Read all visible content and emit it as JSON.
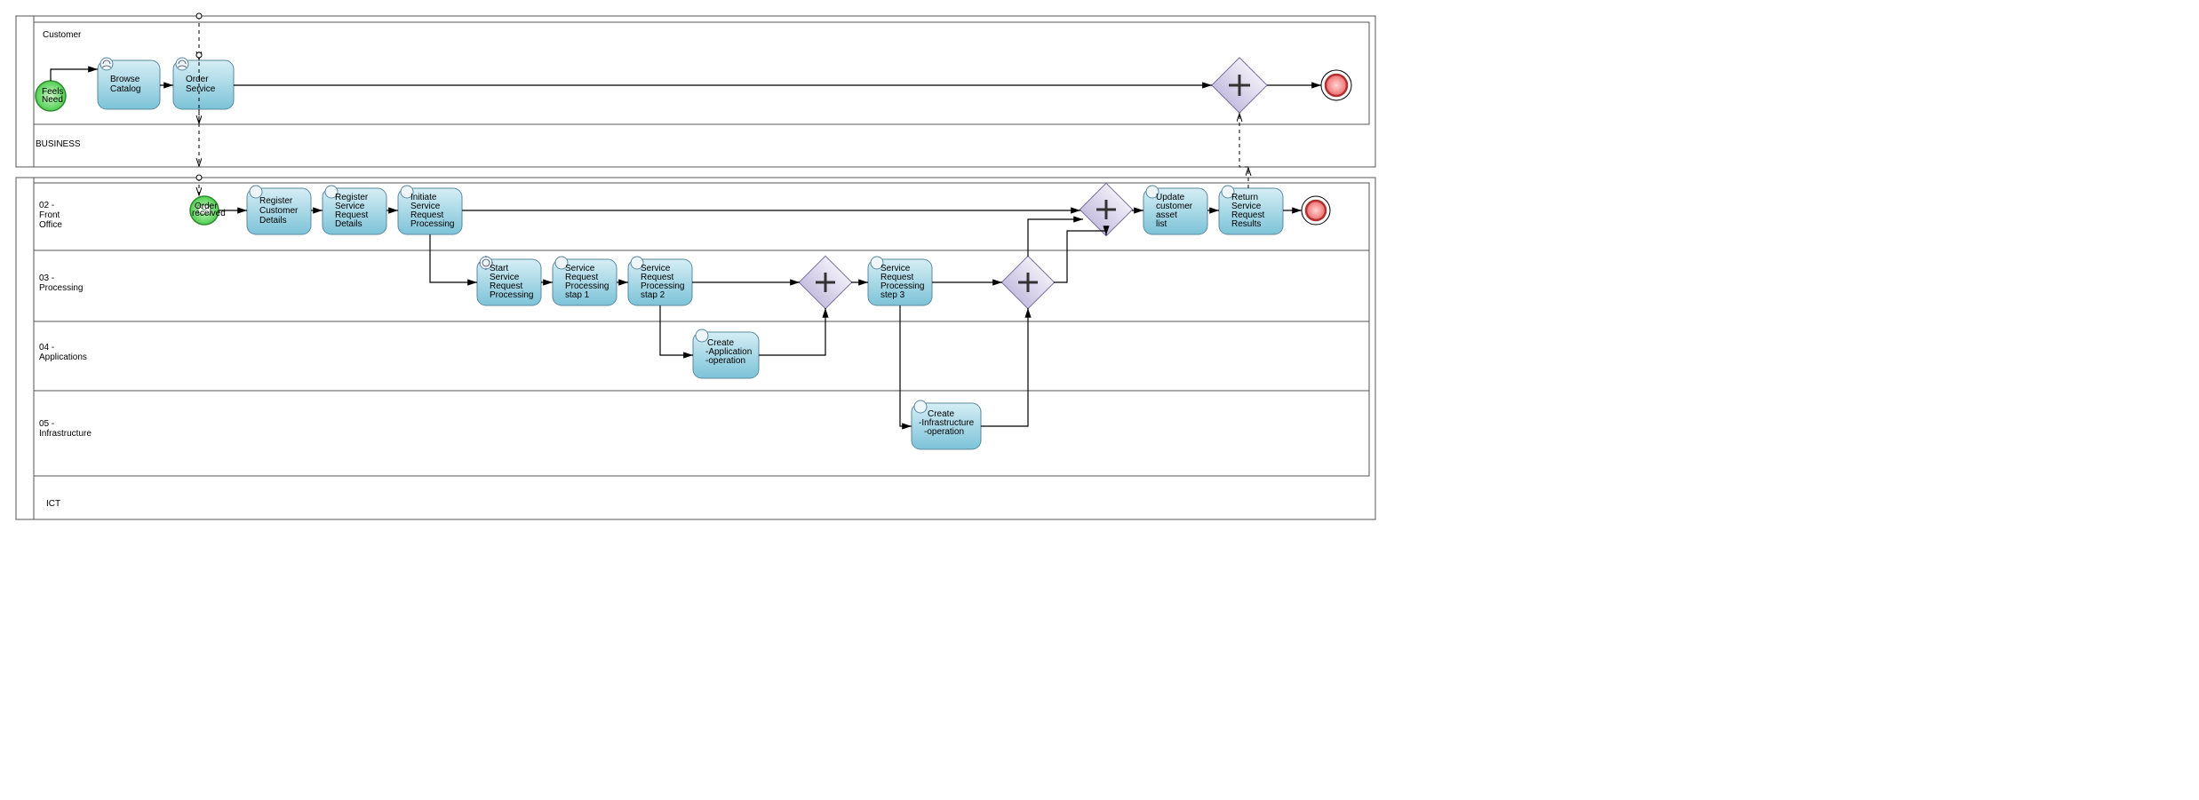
{
  "pools": {
    "business": {
      "label": "BUSINESS"
    },
    "customerLane": {
      "label": "Customer"
    },
    "ict": {
      "label": "ICT"
    },
    "frontOffice": {
      "label": "02 -\nFront\nOffice"
    },
    "processing": {
      "label": "03 -\nProcessing"
    },
    "applications": {
      "label": "04 -\nApplications"
    },
    "infrastructure": {
      "label": "05 -\nInfrastructure"
    }
  },
  "events": {
    "feelsNeed": {
      "label": "Feels\nNeed"
    },
    "orderReceived": {
      "label": "Order\nreceived"
    }
  },
  "tasks": {
    "browseCatalog": "Browse\nCatalog",
    "orderService": "Order\nService",
    "registerCustomerDetails": "Register\nCustomer\nDetails",
    "registerServiceRequestDetails": "Register\nService\nRequest\nDetails",
    "initiateServiceRequestProcessing": "Initiate\nService\nRequest\nProcessing",
    "updateCustomerAssetList": "Update\ncustomer\nasset\nlist",
    "returnServiceRequestResults": "Return\nService\nRequest\nResults",
    "startServiceRequestProcessing": "Start\nService\nRequest\nProcessing",
    "serviceRequestProcessingStep1": "Service\nRequest\nProcessing\nstap 1",
    "serviceRequestProcessingStep2": "Service\nRequest\nProcessing\nstap 2",
    "serviceRequestProcessingStep3": "Service\nRequest\nProcessing\nstep 3",
    "createApplicationOperation": "Create\n-Application\n-operation",
    "createInfrastructureOperation": "Create\n-Infrastructure\n-operation"
  },
  "chart_data": {
    "type": "diagram",
    "notation": "BPMN",
    "pools": [
      {
        "name": "BUSINESS",
        "lanes": [
          {
            "name": "Customer",
            "elements": [
              {
                "id": "feelsNeed",
                "type": "startEvent",
                "label": "Feels Need"
              },
              {
                "id": "browseCatalog",
                "type": "userTask",
                "label": "Browse Catalog"
              },
              {
                "id": "orderService",
                "type": "userTask",
                "label": "Order Service"
              },
              {
                "id": "gwCustomer",
                "type": "parallelGateway"
              },
              {
                "id": "endCustomer",
                "type": "endEvent"
              }
            ]
          }
        ]
      },
      {
        "name": "ICT",
        "lanes": [
          {
            "name": "02 - Front Office",
            "elements": [
              {
                "id": "orderReceived",
                "type": "startEvent",
                "trigger": "message",
                "label": "Order received"
              },
              {
                "id": "registerCustomerDetails",
                "type": "userTask",
                "label": "Register Customer Details"
              },
              {
                "id": "registerServiceRequestDetails",
                "type": "userTask",
                "label": "Register Service Request Details"
              },
              {
                "id": "initiateServiceRequestProcessing",
                "type": "userTask",
                "label": "Initiate Service Request Processing"
              },
              {
                "id": "gwFront",
                "type": "parallelGateway"
              },
              {
                "id": "updateCustomerAssetList",
                "type": "userTask",
                "label": "Update customer asset list"
              },
              {
                "id": "returnServiceRequestResults",
                "type": "userTask",
                "label": "Return Service Request Results"
              },
              {
                "id": "endICT",
                "type": "endEvent"
              }
            ]
          },
          {
            "name": "03 - Processing",
            "elements": [
              {
                "id": "startServiceRequestProcessing",
                "type": "serviceTask",
                "label": "Start Service Request Processing"
              },
              {
                "id": "serviceRequestProcessingStep1",
                "type": "serviceTask",
                "label": "Service Request Processing stap 1"
              },
              {
                "id": "serviceRequestProcessingStep2",
                "type": "serviceTask",
                "label": "Service Request Processing stap 2"
              },
              {
                "id": "gwProc1",
                "type": "parallelGateway"
              },
              {
                "id": "serviceRequestProcessingStep3",
                "type": "serviceTask",
                "label": "Service Request Processing step 3"
              },
              {
                "id": "gwProc2",
                "type": "parallelGateway"
              }
            ]
          },
          {
            "name": "04 - Applications",
            "elements": [
              {
                "id": "createApplicationOperation",
                "type": "serviceTask",
                "label": "Create -Application -operation"
              }
            ]
          },
          {
            "name": "05 - Infrastructure",
            "elements": [
              {
                "id": "createInfrastructureOperation",
                "type": "serviceTask",
                "label": "Create -Infrastructure -operation"
              }
            ]
          }
        ]
      }
    ],
    "sequenceFlows": [
      [
        "feelsNeed",
        "browseCatalog"
      ],
      [
        "browseCatalog",
        "orderService"
      ],
      [
        "orderService",
        "gwCustomer"
      ],
      [
        "gwCustomer",
        "endCustomer"
      ],
      [
        "orderReceived",
        "registerCustomerDetails"
      ],
      [
        "registerCustomerDetails",
        "registerServiceRequestDetails"
      ],
      [
        "registerServiceRequestDetails",
        "initiateServiceRequestProcessing"
      ],
      [
        "initiateServiceRequestProcessing",
        "gwFront"
      ],
      [
        "gwFront",
        "updateCustomerAssetList"
      ],
      [
        "updateCustomerAssetList",
        "returnServiceRequestResults"
      ],
      [
        "returnServiceRequestResults",
        "endICT"
      ],
      [
        "initiateServiceRequestProcessing",
        "startServiceRequestProcessing"
      ],
      [
        "startServiceRequestProcessing",
        "serviceRequestProcessingStep1"
      ],
      [
        "serviceRequestProcessingStep1",
        "serviceRequestProcessingStep2"
      ],
      [
        "serviceRequestProcessingStep2",
        "gwProc1"
      ],
      [
        "gwProc1",
        "serviceRequestProcessingStep3"
      ],
      [
        "serviceRequestProcessingStep3",
        "gwProc2"
      ],
      [
        "gwProc2",
        "gwFront"
      ],
      [
        "serviceRequestProcessingStep2",
        "createApplicationOperation"
      ],
      [
        "createApplicationOperation",
        "gwProc1"
      ],
      [
        "serviceRequestProcessingStep3",
        "createInfrastructureOperation"
      ],
      [
        "createInfrastructureOperation",
        "gwProc2"
      ]
    ],
    "messageFlows": [
      [
        "orderService",
        "orderReceived"
      ],
      [
        "returnServiceRequestResults",
        "gwCustomer"
      ]
    ]
  }
}
